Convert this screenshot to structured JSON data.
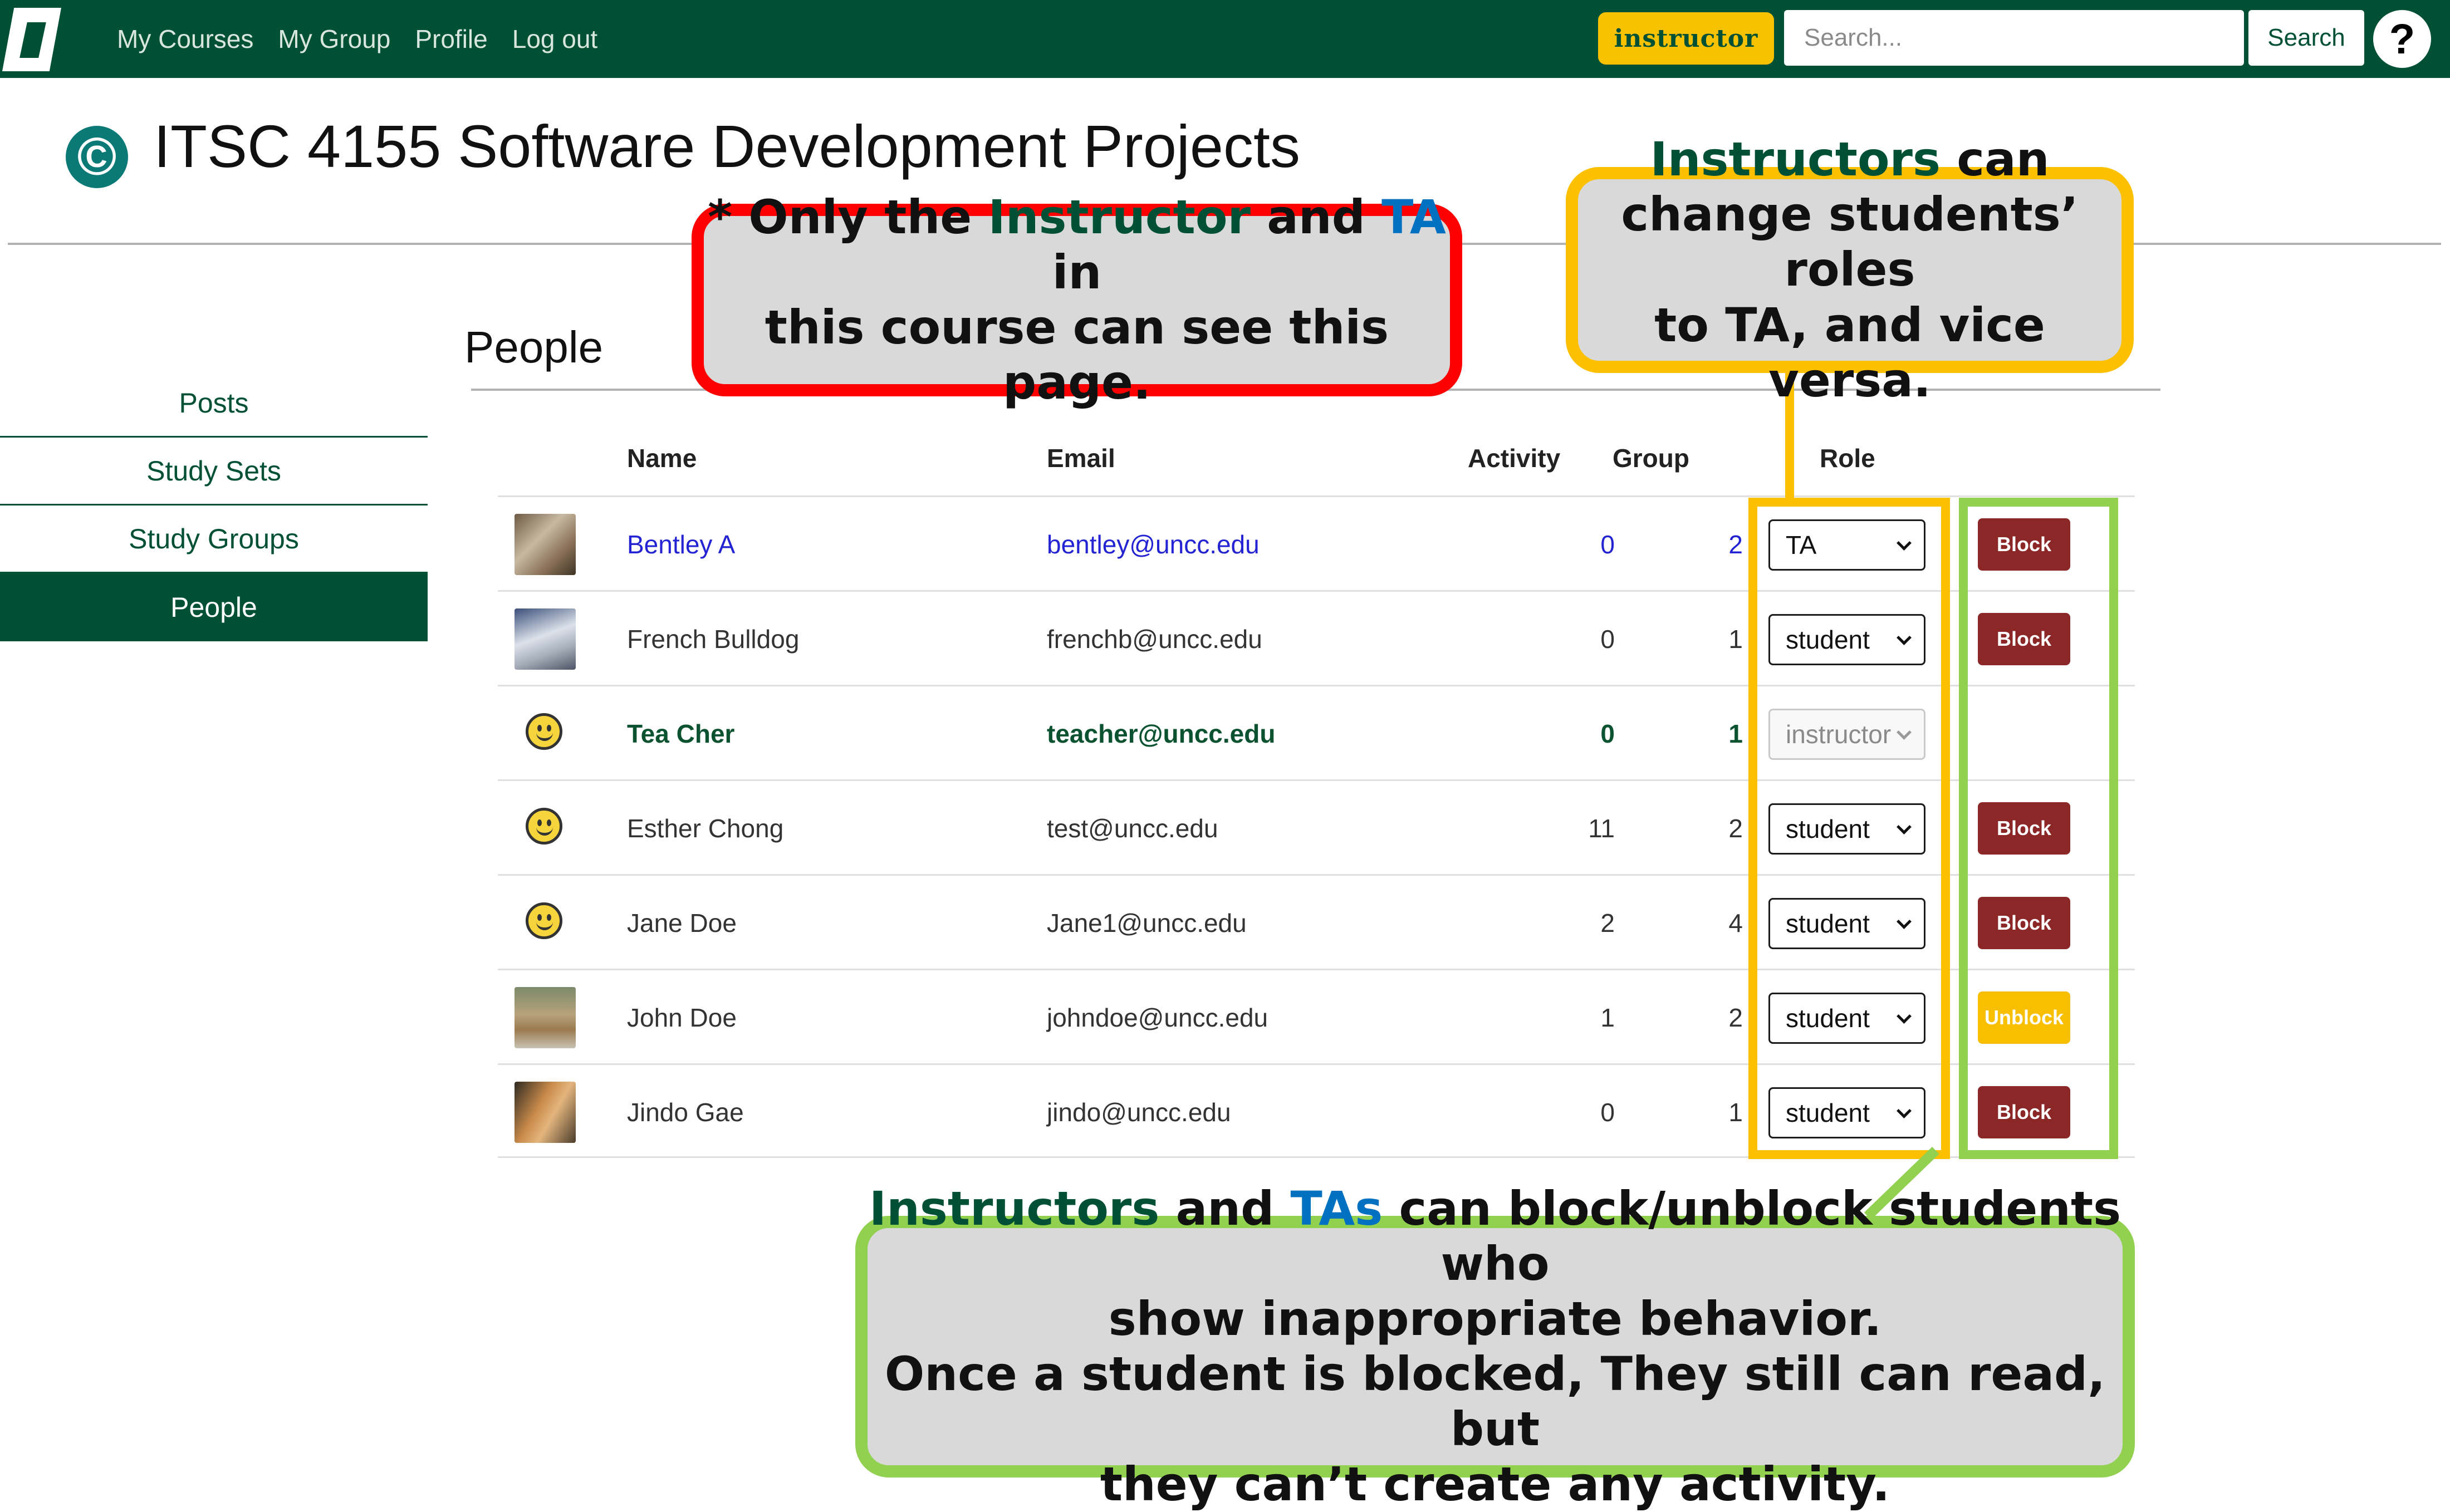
{
  "navbar": {
    "links": [
      "My Courses",
      "My Group",
      "Profile",
      "Log out"
    ],
    "role_badge": "instructor",
    "search_placeholder": "Search...",
    "search_button": "Search",
    "help_icon": "?"
  },
  "course": {
    "icon": "©",
    "title": "ITSC 4155 Software Development Projects"
  },
  "sidebar": {
    "items": [
      {
        "label": "Posts"
      },
      {
        "label": "Study Sets"
      },
      {
        "label": "Study Groups"
      },
      {
        "label": "People",
        "active": true
      }
    ]
  },
  "people": {
    "title": "People",
    "columns": {
      "name": "Name",
      "email": "Email",
      "activity": "Activity",
      "group": "Group",
      "role": "Role"
    },
    "rows": [
      {
        "name": "Bentley A",
        "email": "bentley@uncc.edu",
        "activity": "0",
        "group": "2",
        "role": "TA",
        "action": "Block",
        "avatar": "photo"
      },
      {
        "name": "French Bulldog",
        "email": "frenchb@uncc.edu",
        "activity": "0",
        "group": "1",
        "role": "student",
        "action": "Block",
        "avatar": "photo"
      },
      {
        "name": "Tea Cher",
        "email": "teacher@uncc.edu",
        "activity": "0",
        "group": "1",
        "role": "instructor",
        "action": "",
        "avatar": "smiley"
      },
      {
        "name": "Esther Chong",
        "email": "test@uncc.edu",
        "activity": "11",
        "group": "2",
        "role": "student",
        "action": "Block",
        "avatar": "smiley"
      },
      {
        "name": "Jane Doe",
        "email": "Jane1@uncc.edu",
        "activity": "2",
        "group": "4",
        "role": "student",
        "action": "Block",
        "avatar": "smiley"
      },
      {
        "name": "John Doe",
        "email": "johndoe@uncc.edu",
        "activity": "1",
        "group": "2",
        "role": "student",
        "action": "Unblock",
        "avatar": "photo"
      },
      {
        "name": "Jindo Gae",
        "email": "jindo@uncc.edu",
        "activity": "0",
        "group": "1",
        "role": "student",
        "action": "Block",
        "avatar": "photo"
      }
    ]
  },
  "callouts": {
    "red": {
      "l1_a": "* Only the ",
      "l1_b": "Instructor",
      "l1_c": " and ",
      "l1_d": "TA",
      "l1_e": " in",
      "l2": "this course can see this page."
    },
    "yellow": {
      "l1_a": "Instructors",
      "l1_b": " can",
      "l2": "change students’ roles",
      "l3": "to TA, and vice versa."
    },
    "green": {
      "l1_a": "Instructors",
      "l1_b": " and ",
      "l1_c": "TAs",
      "l1_d": " can block/unblock students who",
      "l2": "show inappropriate behavior.",
      "l3": "Once a student is blocked, They still can read, but",
      "l4": "they can’t create any activity."
    }
  },
  "colors": {
    "brand": "#005035",
    "gold": "#f8c200",
    "block": "#8b2727",
    "link": "#2323d4",
    "annotation_red": "#ff0000",
    "annotation_yellow": "#fcc000",
    "annotation_green": "#92d050"
  }
}
